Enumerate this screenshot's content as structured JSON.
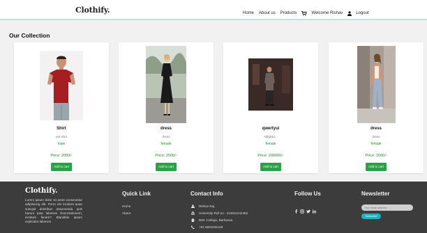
{
  "navbar": {
    "brand": "Clothify.",
    "links": [
      "Home",
      "About us",
      "Products"
    ],
    "welcome": "Welcome Rishav",
    "logout": "Logout"
  },
  "section_title": "Our Collection",
  "products": [
    {
      "name": "Shirt",
      "desc": "red shirt",
      "gender": "male",
      "price": "Price: 2000/-",
      "button": "Add to cart"
    },
    {
      "name": "dress",
      "desc": "dress",
      "gender": "female",
      "price": "Price: 2500/-",
      "button": "Add to cart"
    },
    {
      "name": "qwertyui",
      "desc": "sdfghjkl...",
      "gender": "female",
      "price": "Price: 200000/-",
      "button": "Add to cart"
    },
    {
      "name": "dress",
      "desc": "dress",
      "gender": "female",
      "price": "Price: 2000/-",
      "button": "Add to cart"
    }
  ],
  "footer": {
    "brand": "Clothify.",
    "about": "Lorem ipsum dolor sit amet consectetur adipisicing elit. Porro est incidunt quae suscipit doloribus assumenda quis harum Ipsa laborum Exercitationem, incidunt facere? Blanditiis ipsum explicabo laborum",
    "quick_link_heading": "Quick Link",
    "quick_links": [
      "Home",
      "About"
    ],
    "contact_heading": "Contact Info",
    "contact": {
      "name": "Rishav Raj",
      "roll": "University Roll no - 210011242462",
      "college": "BSK College, Barharwa",
      "phone": "+91 8291031149"
    },
    "follow_heading": "Follow Us",
    "newsletter_heading": "Newsletter",
    "email_placeholder": "Your email address",
    "subscribe": "Subscribe"
  },
  "colors": {
    "accent_green": "#27a345",
    "footer_bg": "#3c3c3c",
    "subscribe_blue": "#1fb0c4"
  }
}
